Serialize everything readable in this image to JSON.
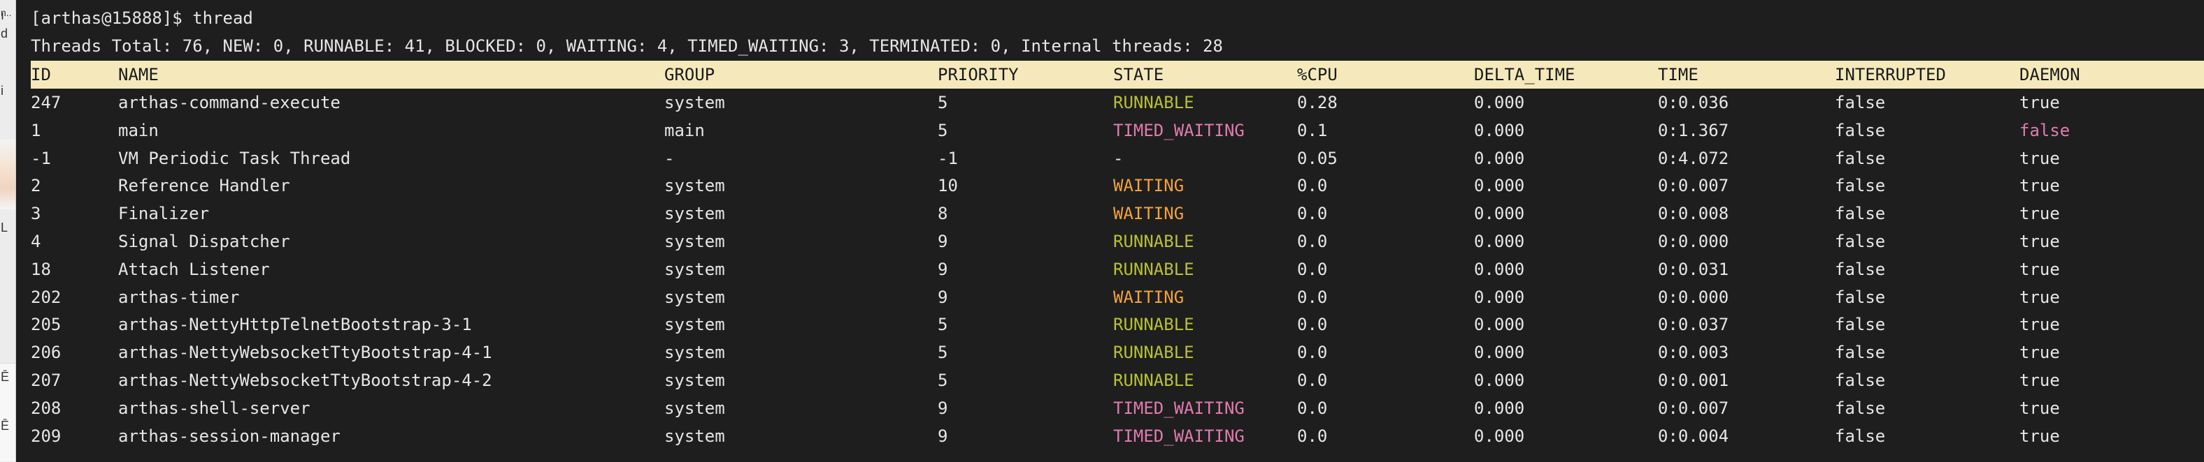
{
  "side_strip": {
    "fragments": [
      {
        "text": "ı"
      },
      {
        "text": "n.."
      },
      {
        "text": "d"
      },
      {
        "text": "i"
      },
      {
        "text": "L"
      },
      {
        "text": "Ē"
      },
      {
        "text": "Ē"
      }
    ]
  },
  "terminal": {
    "prompt": "[arthas@15888]$ thread",
    "summary": "Threads Total: 76, NEW: 0, RUNNABLE: 41, BLOCKED: 0, WAITING: 4, TIMED_WAITING: 3, TERMINATED: 0, Internal threads: 28",
    "headers": {
      "id": "ID",
      "name": "NAME",
      "group": "GROUP",
      "priority": "PRIORITY",
      "state": "STATE",
      "cpu": "%CPU",
      "delta_time": "DELTA_TIME",
      "time": "TIME",
      "interrupted": "INTERRUPTED",
      "daemon": "DAEMON"
    },
    "state_colors": {
      "RUNNABLE": "#b8c035",
      "TIMED_WAITING": "#e07bb0",
      "WAITING": "#f3a23a"
    },
    "rows": [
      {
        "id": "247",
        "name": "arthas-command-execute",
        "group": "system",
        "priority": "5",
        "state": "RUNNABLE",
        "cpu": "0.28",
        "delta_time": "0.000",
        "time": "0:0.036",
        "interrupted": "false",
        "daemon": "true"
      },
      {
        "id": "1",
        "name": "main",
        "group": "main",
        "priority": "5",
        "state": "TIMED_WAITING",
        "cpu": "0.1",
        "delta_time": "0.000",
        "time": "0:1.367",
        "interrupted": "false",
        "daemon": "false"
      },
      {
        "id": "-1",
        "name": "VM Periodic Task Thread",
        "group": "-",
        "priority": "-1",
        "state": "-",
        "cpu": "0.05",
        "delta_time": "0.000",
        "time": "0:4.072",
        "interrupted": "false",
        "daemon": "true"
      },
      {
        "id": "2",
        "name": "Reference Handler",
        "group": "system",
        "priority": "10",
        "state": "WAITING",
        "cpu": "0.0",
        "delta_time": "0.000",
        "time": "0:0.007",
        "interrupted": "false",
        "daemon": "true"
      },
      {
        "id": "3",
        "name": "Finalizer",
        "group": "system",
        "priority": "8",
        "state": "WAITING",
        "cpu": "0.0",
        "delta_time": "0.000",
        "time": "0:0.008",
        "interrupted": "false",
        "daemon": "true"
      },
      {
        "id": "4",
        "name": "Signal Dispatcher",
        "group": "system",
        "priority": "9",
        "state": "RUNNABLE",
        "cpu": "0.0",
        "delta_time": "0.000",
        "time": "0:0.000",
        "interrupted": "false",
        "daemon": "true"
      },
      {
        "id": "18",
        "name": "Attach Listener",
        "group": "system",
        "priority": "9",
        "state": "RUNNABLE",
        "cpu": "0.0",
        "delta_time": "0.000",
        "time": "0:0.031",
        "interrupted": "false",
        "daemon": "true"
      },
      {
        "id": "202",
        "name": "arthas-timer",
        "group": "system",
        "priority": "9",
        "state": "WAITING",
        "cpu": "0.0",
        "delta_time": "0.000",
        "time": "0:0.000",
        "interrupted": "false",
        "daemon": "true"
      },
      {
        "id": "205",
        "name": "arthas-NettyHttpTelnetBootstrap-3-1",
        "group": "system",
        "priority": "5",
        "state": "RUNNABLE",
        "cpu": "0.0",
        "delta_time": "0.000",
        "time": "0:0.037",
        "interrupted": "false",
        "daemon": "true"
      },
      {
        "id": "206",
        "name": "arthas-NettyWebsocketTtyBootstrap-4-1",
        "group": "system",
        "priority": "5",
        "state": "RUNNABLE",
        "cpu": "0.0",
        "delta_time": "0.000",
        "time": "0:0.003",
        "interrupted": "false",
        "daemon": "true"
      },
      {
        "id": "207",
        "name": "arthas-NettyWebsocketTtyBootstrap-4-2",
        "group": "system",
        "priority": "5",
        "state": "RUNNABLE",
        "cpu": "0.0",
        "delta_time": "0.000",
        "time": "0:0.001",
        "interrupted": "false",
        "daemon": "true"
      },
      {
        "id": "208",
        "name": "arthas-shell-server",
        "group": "system",
        "priority": "9",
        "state": "TIMED_WAITING",
        "cpu": "0.0",
        "delta_time": "0.000",
        "time": "0:0.007",
        "interrupted": "false",
        "daemon": "true"
      },
      {
        "id": "209",
        "name": "arthas-session-manager",
        "group": "system",
        "priority": "9",
        "state": "TIMED_WAITING",
        "cpu": "0.0",
        "delta_time": "0.000",
        "time": "0:0.004",
        "interrupted": "false",
        "daemon": "true"
      }
    ]
  }
}
